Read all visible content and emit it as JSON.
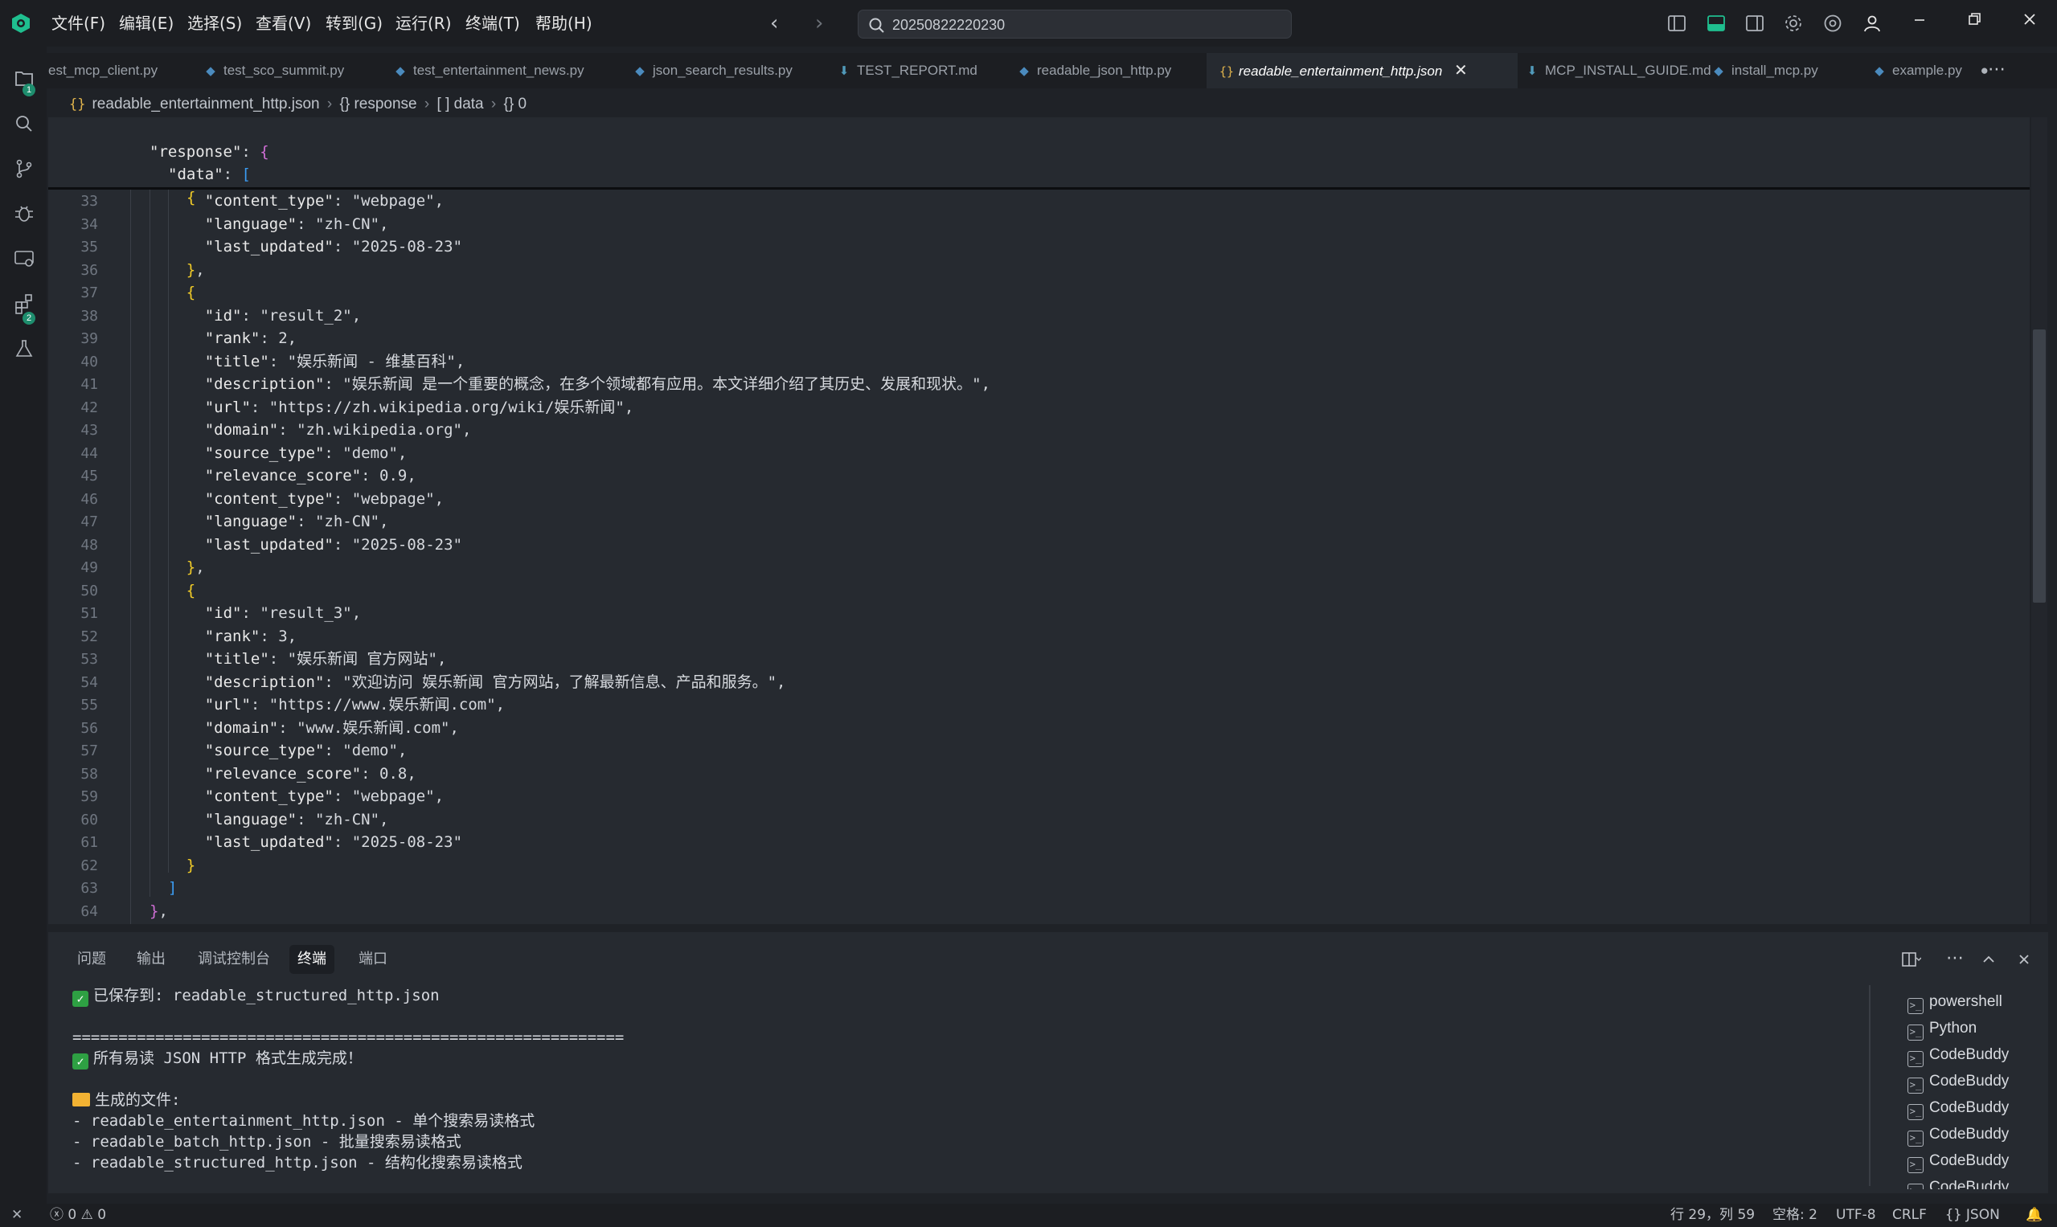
{
  "titlebar": {
    "menu": [
      "文件(F)",
      "编辑(E)",
      "选择(S)",
      "查看(V)",
      "转到(G)",
      "运行(R)",
      "终端(T)",
      "帮助(H)"
    ],
    "search_text": "20250822220230"
  },
  "activity": {
    "explorer_badge": "1",
    "extensions_badge": "2"
  },
  "tabs": [
    {
      "label": "est_mcp_client.py",
      "kind": "python"
    },
    {
      "label": "test_sco_summit.py",
      "kind": "python"
    },
    {
      "label": "test_entertainment_news.py",
      "kind": "python"
    },
    {
      "label": "json_search_results.py",
      "kind": "python"
    },
    {
      "label": "TEST_REPORT.md",
      "kind": "markdown"
    },
    {
      "label": "readable_json_http.py",
      "kind": "python"
    },
    {
      "label": "readable_entertainment_http.json",
      "kind": "json",
      "active": true
    },
    {
      "label": "MCP_INSTALL_GUIDE.md",
      "kind": "markdown"
    },
    {
      "label": "install_mcp.py",
      "kind": "python"
    },
    {
      "label": "example.py",
      "kind": "python"
    }
  ],
  "breadcrumb": {
    "file": "readable_entertainment_http.json",
    "response": "response",
    "data": "data",
    "index": "0",
    "obj_glyph": "{}",
    "arr_glyph": "[ ]"
  },
  "sticky": {
    "response_key": "\"response\"",
    "data_key": "\"data\""
  },
  "code_lines": [
    {
      "n": "33",
      "t": "      \"content_type\": \"webpage\","
    },
    {
      "n": "34",
      "t": "      \"language\": \"zh-CN\","
    },
    {
      "n": "35",
      "t": "      \"last_updated\": \"2025-08-23\""
    },
    {
      "n": "36",
      "t": "    },"
    },
    {
      "n": "37",
      "t": "    {"
    },
    {
      "n": "38",
      "t": "      \"id\": \"result_2\","
    },
    {
      "n": "39",
      "t": "      \"rank\": 2,"
    },
    {
      "n": "40",
      "t": "      \"title\": \"娱乐新闻 - 维基百科\","
    },
    {
      "n": "41",
      "t": "      \"description\": \"娱乐新闻 是一个重要的概念，在多个领域都有应用。本文详细介绍了其历史、发展和现状。\","
    },
    {
      "n": "42",
      "t": "      \"url\": \"https://zh.wikipedia.org/wiki/娱乐新闻\","
    },
    {
      "n": "43",
      "t": "      \"domain\": \"zh.wikipedia.org\","
    },
    {
      "n": "44",
      "t": "      \"source_type\": \"demo\","
    },
    {
      "n": "45",
      "t": "      \"relevance_score\": 0.9,"
    },
    {
      "n": "46",
      "t": "      \"content_type\": \"webpage\","
    },
    {
      "n": "47",
      "t": "      \"language\": \"zh-CN\","
    },
    {
      "n": "48",
      "t": "      \"last_updated\": \"2025-08-23\""
    },
    {
      "n": "49",
      "t": "    },"
    },
    {
      "n": "50",
      "t": "    {"
    },
    {
      "n": "51",
      "t": "      \"id\": \"result_3\","
    },
    {
      "n": "52",
      "t": "      \"rank\": 3,"
    },
    {
      "n": "53",
      "t": "      \"title\": \"娱乐新闻 官方网站\","
    },
    {
      "n": "54",
      "t": "      \"description\": \"欢迎访问 娱乐新闻 官方网站，了解最新信息、产品和服务。\","
    },
    {
      "n": "55",
      "t": "      \"url\": \"https://www.娱乐新闻.com\","
    },
    {
      "n": "56",
      "t": "      \"domain\": \"www.娱乐新闻.com\","
    },
    {
      "n": "57",
      "t": "      \"source_type\": \"demo\","
    },
    {
      "n": "58",
      "t": "      \"relevance_score\": 0.8,"
    },
    {
      "n": "59",
      "t": "      \"content_type\": \"webpage\","
    },
    {
      "n": "60",
      "t": "      \"language\": \"zh-CN\","
    },
    {
      "n": "61",
      "t": "      \"last_updated\": \"2025-08-23\""
    },
    {
      "n": "62",
      "t": "    }"
    },
    {
      "n": "63",
      "t": "  ]"
    },
    {
      "n": "64",
      "t": "},"
    }
  ],
  "panel": {
    "tabs": [
      "问题",
      "输出",
      "调试控制台",
      "终端",
      "端口"
    ],
    "active_tab": "终端",
    "terminal_lines": [
      {
        "text": "已保存到: readable_structured_http.json",
        "icon": "check"
      },
      {
        "text": "",
        "icon": ""
      },
      {
        "text": "============================================================",
        "icon": ""
      },
      {
        "text": "所有易读 JSON HTTP 格式生成完成！",
        "icon": "check"
      },
      {
        "text": "",
        "icon": ""
      },
      {
        "text": "生成的文件:",
        "icon": "folder"
      },
      {
        "text": "- readable_entertainment_http.json - 单个搜索易读格式",
        "icon": ""
      },
      {
        "text": "- readable_batch_http.json - 批量搜索易读格式",
        "icon": ""
      },
      {
        "text": "- readable_structured_http.json - 结构化搜索易读格式",
        "icon": ""
      }
    ],
    "terminals": [
      "powershell",
      "Python",
      "CodeBuddy",
      "CodeBuddy",
      "CodeBuddy",
      "CodeBuddy",
      "CodeBuddy",
      "CodeBuddy"
    ]
  },
  "status": {
    "errors": "0",
    "warnings": "0",
    "position": "行 29，列 59",
    "indent": "空格: 2",
    "encoding": "UTF-8",
    "eol": "CRLF",
    "language": "JSON",
    "language_glyph": "{}"
  },
  "colors": {
    "accent": "#1e8e6e",
    "string": "#e09a63",
    "bracket_yellow": "#f2cc28",
    "bracket_purple": "#d06fd6",
    "bracket_blue": "#3b9cf2"
  }
}
